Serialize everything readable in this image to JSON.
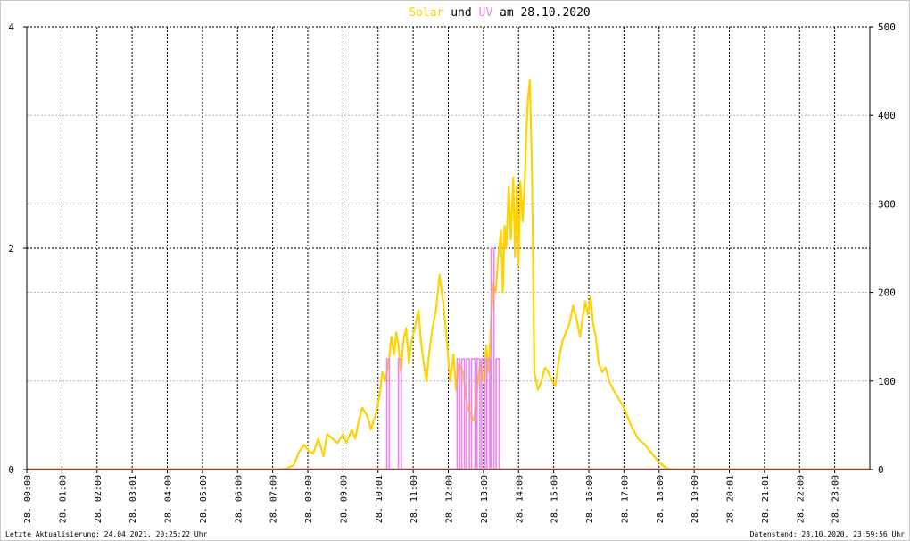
{
  "chart_data": {
    "type": "line",
    "title": {
      "solar_word": "Solar",
      "and_word": "und",
      "uv_word": "UV",
      "date_phrase": "am 28.10.2020"
    },
    "colors": {
      "solar": "#ffd200",
      "uv": "#ee82ee",
      "baseline": "#ff8f6b",
      "grid": "#000000",
      "text": "#000000"
    },
    "y_left": {
      "min": 0,
      "max": 4,
      "ticks": [
        "0",
        "2",
        "4"
      ]
    },
    "y_right": {
      "min": 0,
      "max": 500,
      "ticks": [
        "0",
        "100",
        "200",
        "300",
        "400",
        "500"
      ]
    },
    "x_range": [
      0,
      24
    ],
    "x_ticks": [
      "28. 00:00",
      "28. 01:00",
      "28. 02:00",
      "28. 03:01",
      "28. 04:00",
      "28. 05:00",
      "28. 06:00",
      "28. 07:00",
      "28. 08:00",
      "28. 09:00",
      "28. 10:01",
      "28. 11:00",
      "28. 12:00",
      "28. 13:00",
      "28. 14:00",
      "28. 15:00",
      "28. 16:00",
      "28. 17:00",
      "28. 18:00",
      "28. 19:00",
      "28. 20:01",
      "28. 21:01",
      "28. 22:00",
      "28. 23:00"
    ],
    "series": [
      {
        "name": "Solar",
        "axis": "right",
        "points": [
          [
            0,
            0
          ],
          [
            7.1,
            0
          ],
          [
            7.4,
            1
          ],
          [
            7.6,
            5
          ],
          [
            7.75,
            20
          ],
          [
            7.9,
            28
          ],
          [
            8.0,
            22
          ],
          [
            8.15,
            18
          ],
          [
            8.3,
            35
          ],
          [
            8.45,
            15
          ],
          [
            8.55,
            40
          ],
          [
            8.7,
            35
          ],
          [
            8.85,
            30
          ],
          [
            9.0,
            40
          ],
          [
            9.1,
            30
          ],
          [
            9.25,
            45
          ],
          [
            9.35,
            35
          ],
          [
            9.45,
            55
          ],
          [
            9.55,
            70
          ],
          [
            9.7,
            60
          ],
          [
            9.8,
            45
          ],
          [
            9.95,
            65
          ],
          [
            10.05,
            85
          ],
          [
            10.12,
            110
          ],
          [
            10.2,
            100
          ],
          [
            10.3,
            120
          ],
          [
            10.38,
            150
          ],
          [
            10.45,
            130
          ],
          [
            10.52,
            155
          ],
          [
            10.58,
            140
          ],
          [
            10.65,
            110
          ],
          [
            10.72,
            145
          ],
          [
            10.8,
            160
          ],
          [
            10.88,
            120
          ],
          [
            10.95,
            145
          ],
          [
            11.05,
            160
          ],
          [
            11.15,
            180
          ],
          [
            11.22,
            145
          ],
          [
            11.3,
            120
          ],
          [
            11.38,
            100
          ],
          [
            11.45,
            130
          ],
          [
            11.55,
            160
          ],
          [
            11.65,
            180
          ],
          [
            11.75,
            220
          ],
          [
            11.85,
            190
          ],
          [
            11.95,
            150
          ],
          [
            12.05,
            100
          ],
          [
            12.15,
            130
          ],
          [
            12.22,
            90
          ],
          [
            12.3,
            120
          ],
          [
            12.42,
            110
          ],
          [
            12.55,
            70
          ],
          [
            12.65,
            60
          ],
          [
            12.72,
            55
          ],
          [
            12.8,
            80
          ],
          [
            12.9,
            120
          ],
          [
            13.0,
            100
          ],
          [
            13.08,
            140
          ],
          [
            13.15,
            110
          ],
          [
            13.22,
            170
          ],
          [
            13.28,
            210
          ],
          [
            13.35,
            200
          ],
          [
            13.42,
            240
          ],
          [
            13.5,
            270
          ],
          [
            13.55,
            200
          ],
          [
            13.6,
            275
          ],
          [
            13.65,
            250
          ],
          [
            13.72,
            320
          ],
          [
            13.78,
            260
          ],
          [
            13.85,
            330
          ],
          [
            13.9,
            240
          ],
          [
            13.95,
            320
          ],
          [
            14.0,
            230
          ],
          [
            14.05,
            325
          ],
          [
            14.12,
            280
          ],
          [
            14.18,
            330
          ],
          [
            14.22,
            380
          ],
          [
            14.27,
            420
          ],
          [
            14.32,
            440
          ],
          [
            14.38,
            340
          ],
          [
            14.45,
            110
          ],
          [
            14.55,
            90
          ],
          [
            14.65,
            100
          ],
          [
            14.75,
            115
          ],
          [
            14.85,
            110
          ],
          [
            14.95,
            100
          ],
          [
            15.05,
            95
          ],
          [
            15.15,
            125
          ],
          [
            15.25,
            145
          ],
          [
            15.35,
            155
          ],
          [
            15.45,
            165
          ],
          [
            15.55,
            185
          ],
          [
            15.65,
            170
          ],
          [
            15.75,
            150
          ],
          [
            15.82,
            170
          ],
          [
            15.9,
            190
          ],
          [
            15.97,
            175
          ],
          [
            16.05,
            195
          ],
          [
            16.12,
            165
          ],
          [
            16.2,
            150
          ],
          [
            16.28,
            120
          ],
          [
            16.38,
            110
          ],
          [
            16.48,
            115
          ],
          [
            16.58,
            100
          ],
          [
            16.7,
            90
          ],
          [
            16.85,
            80
          ],
          [
            17.0,
            70
          ],
          [
            17.2,
            50
          ],
          [
            17.4,
            35
          ],
          [
            17.6,
            28
          ],
          [
            17.8,
            18
          ],
          [
            18.0,
            8
          ],
          [
            18.2,
            2
          ],
          [
            18.4,
            0
          ],
          [
            24,
            0
          ]
        ]
      },
      {
        "name": "UV",
        "axis": "left",
        "points": [
          [
            0,
            0
          ],
          [
            10.25,
            0
          ],
          [
            10.25,
            1
          ],
          [
            10.32,
            1
          ],
          [
            10.32,
            0
          ],
          [
            10.58,
            0
          ],
          [
            10.58,
            1
          ],
          [
            10.66,
            1
          ],
          [
            10.66,
            0
          ],
          [
            12.25,
            0
          ],
          [
            12.25,
            1
          ],
          [
            12.32,
            1
          ],
          [
            12.32,
            0
          ],
          [
            12.38,
            0
          ],
          [
            12.38,
            1
          ],
          [
            12.46,
            1
          ],
          [
            12.46,
            0
          ],
          [
            12.52,
            0
          ],
          [
            12.52,
            1
          ],
          [
            12.6,
            1
          ],
          [
            12.6,
            0
          ],
          [
            12.66,
            0
          ],
          [
            12.66,
            1
          ],
          [
            12.76,
            1
          ],
          [
            12.76,
            0
          ],
          [
            12.82,
            0
          ],
          [
            12.82,
            1
          ],
          [
            12.9,
            1
          ],
          [
            12.9,
            0
          ],
          [
            12.95,
            0
          ],
          [
            12.95,
            1
          ],
          [
            13.05,
            1
          ],
          [
            13.05,
            0
          ],
          [
            13.1,
            0
          ],
          [
            13.1,
            1
          ],
          [
            13.18,
            1
          ],
          [
            13.18,
            0
          ],
          [
            13.22,
            0
          ],
          [
            13.22,
            2
          ],
          [
            13.3,
            2
          ],
          [
            13.3,
            0
          ],
          [
            13.36,
            0
          ],
          [
            13.36,
            1
          ],
          [
            13.45,
            1
          ],
          [
            13.45,
            0
          ],
          [
            24,
            0
          ]
        ]
      }
    ]
  },
  "footer": {
    "left": "Letzte Aktualisierung: 24.04.2021, 20:25:22 Uhr",
    "right": "Datenstand: 28.10.2020, 23:59:56 Uhr"
  }
}
